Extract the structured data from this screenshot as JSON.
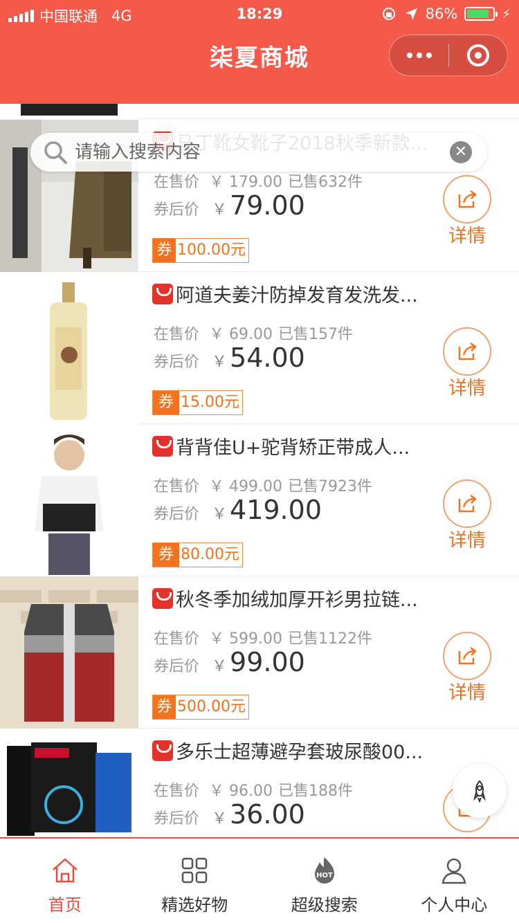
{
  "status_bar": {
    "carrier": "中国联通",
    "network": "4G",
    "time": "18:29",
    "battery": "86%",
    "battery_level": 0.86
  },
  "header": {
    "title": "柒夏商城",
    "accent_color": "#f4594a"
  },
  "search": {
    "placeholder": "请输入搜索内容"
  },
  "labels": {
    "price_label": "在售价",
    "after_label": "券后价",
    "coupon_label": "券",
    "detail_label": "详情",
    "yen": "￥"
  },
  "products": [
    {
      "name": "马丁靴女靴子2018秋季新款...",
      "price": "179.00",
      "sold": "已售632件",
      "after_price": "79.00",
      "coupon": "100.00元"
    },
    {
      "name": "阿道夫姜汁防掉发育发洗发...",
      "price": "69.00",
      "sold": "已售157件",
      "after_price": "54.00",
      "coupon": "15.00元"
    },
    {
      "name": "背背佳U+驼背矫正带成人...",
      "price": "499.00",
      "sold": "已售7923件",
      "after_price": "419.00",
      "coupon": "80.00元"
    },
    {
      "name": "秋冬季加绒加厚开衫男拉链...",
      "price": "599.00",
      "sold": "已售1122件",
      "after_price": "99.00",
      "coupon": "500.00元"
    },
    {
      "name": "多乐士超薄避孕套玻尿酸00...",
      "price": "96.00",
      "sold": "已售188件",
      "after_price": "36.00",
      "coupon": ""
    }
  ],
  "tabbar": {
    "items": [
      {
        "label": "首页",
        "icon": "home-icon",
        "active": true
      },
      {
        "label": "精选好物",
        "icon": "grid-icon",
        "active": false
      },
      {
        "label": "超级搜索",
        "icon": "hot-icon",
        "active": false
      },
      {
        "label": "个人中心",
        "icon": "user-icon",
        "active": false
      }
    ]
  }
}
